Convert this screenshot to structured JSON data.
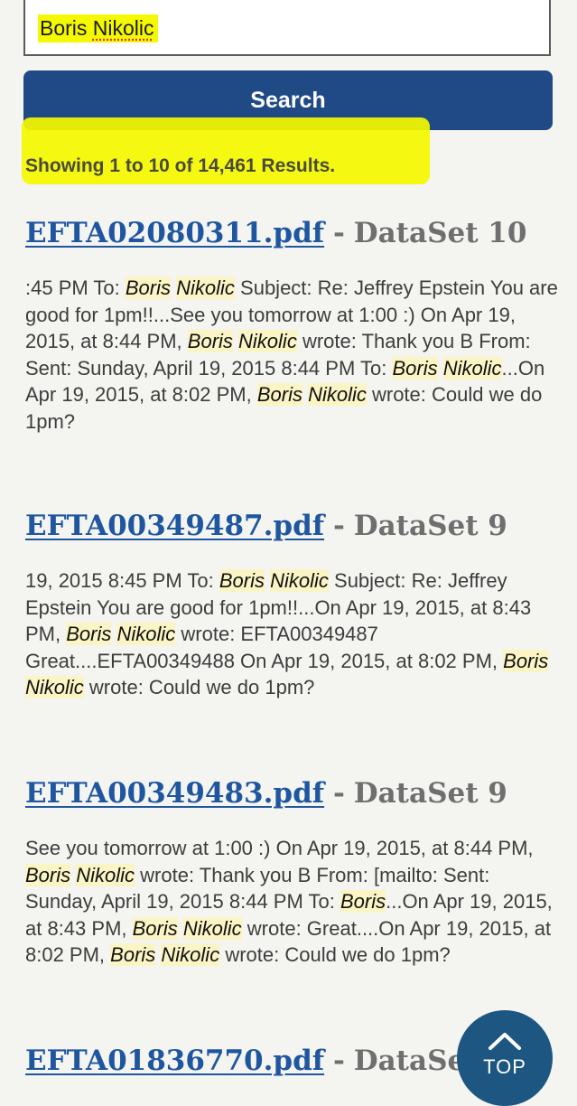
{
  "search": {
    "query_first": "Boris",
    "query_second": "Nikolic",
    "button_label": "Search"
  },
  "summary": {
    "count_text": "Showing 1 to 10 of 14,461 Results."
  },
  "results": [
    {
      "file": "EFTA02080311.pdf",
      "separator": "-",
      "dataset": "DataSet 10",
      "snippet": [
        {
          "t": ":45 PM To: "
        },
        {
          "t": "Boris",
          "hit": true
        },
        {
          "t": " "
        },
        {
          "t": "Nikolic",
          "hit": true
        },
        {
          "t": " Subject: Re: Jeffrey Epstein You are good for 1pm!!...See you tomorrow at 1:00 :) On Apr 19, 2015, at 8:44 PM, "
        },
        {
          "t": "Boris",
          "hit": true
        },
        {
          "t": " "
        },
        {
          "t": "Nikolic",
          "hit": true
        },
        {
          "t": " wrote: Thank you B From: Sent: Sunday, April 19, 2015 8:44 PM To: "
        },
        {
          "t": "Boris",
          "hit": true
        },
        {
          "t": " "
        },
        {
          "t": "Nikolic",
          "hit": true
        },
        {
          "t": "...On Apr 19, 2015, at 8:02 PM, "
        },
        {
          "t": "Boris",
          "hit": true
        },
        {
          "t": " "
        },
        {
          "t": "Nikolic",
          "hit": true
        },
        {
          "t": " wrote: Could we do 1pm?"
        }
      ]
    },
    {
      "file": "EFTA00349487.pdf",
      "separator": "-",
      "dataset": "DataSet 9",
      "snippet": [
        {
          "t": "19, 2015 8:45 PM To: "
        },
        {
          "t": "Boris",
          "hit": true
        },
        {
          "t": " "
        },
        {
          "t": "Nikolic",
          "hit": true
        },
        {
          "t": " Subject: Re: Jeffrey Epstein You are good for 1pm!!...On Apr 19, 2015, at 8:43 PM, "
        },
        {
          "t": "Boris",
          "hit": true
        },
        {
          "t": " "
        },
        {
          "t": "Nikolic",
          "hit": true
        },
        {
          "t": " wrote: EFTA00349487 Great....EFTA00349488 On Apr 19, 2015, at 8:02 PM, "
        },
        {
          "t": "Boris",
          "hit": true
        },
        {
          "t": " "
        },
        {
          "t": "Nikolic",
          "hit": true
        },
        {
          "t": " wrote: Could we do 1pm?"
        }
      ]
    },
    {
      "file": "EFTA00349483.pdf",
      "separator": "-",
      "dataset": "DataSet 9",
      "snippet": [
        {
          "t": "See you tomorrow at 1:00 :) On Apr 19, 2015, at 8:44 PM, "
        },
        {
          "t": "Boris",
          "hit": true
        },
        {
          "t": " "
        },
        {
          "t": "Nikolic",
          "hit": true
        },
        {
          "t": " wrote: Thank you B From: [mailto: Sent: Sunday, April 19, 2015 8:44 PM To: "
        },
        {
          "t": "Boris",
          "hit": true
        },
        {
          "t": "...On Apr 19, 2015, at 8:43 PM, "
        },
        {
          "t": "Boris",
          "hit": true
        },
        {
          "t": " "
        },
        {
          "t": "Nikolic",
          "hit": true
        },
        {
          "t": " wrote: Great....On Apr 19, 2015, at 8:02 PM, "
        },
        {
          "t": "Boris",
          "hit": true
        },
        {
          "t": " "
        },
        {
          "t": "Nikolic",
          "hit": true
        },
        {
          "t": " wrote: Could we do 1pm?"
        }
      ]
    },
    {
      "file": "EFTA01836770.pdf",
      "separator": "-",
      "dataset": "DataSet",
      "snippet": []
    }
  ],
  "back_to_top": {
    "label": "TOP",
    "icon": "chevron-up-icon"
  },
  "colors": {
    "search_button": "#1f4a86",
    "link": "#1f56a0",
    "highlight_marker": "#f4f800",
    "hit_background": "#fbf4c4",
    "top_button": "#1d5680"
  }
}
